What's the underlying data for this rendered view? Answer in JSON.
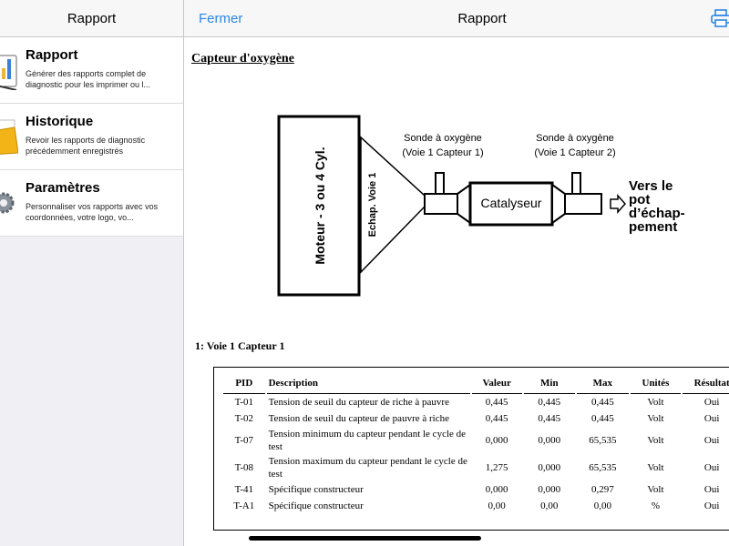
{
  "sidebar": {
    "title": "Rapport",
    "items": [
      {
        "title": "Rapport",
        "desc": "Générer des rapports complet de diagnostic pour les imprimer ou l...",
        "icon": "report-icon"
      },
      {
        "title": "Historique",
        "desc": "Revoir les rapports de diagnostic précédemment enregistrés",
        "icon": "folder-icon"
      },
      {
        "title": "Paramètres",
        "desc": "Personnaliser vos rapports avec vos coordonnées, votre logo, vo...",
        "icon": "gear-icon"
      }
    ]
  },
  "main": {
    "close_label": "Fermer",
    "title": "Rapport",
    "section_title": "Capteur d'oxygène",
    "diagram": {
      "engine_label": "Moteur - 3 ou 4 Cyl.",
      "exhaust_label": "Echap. Voie 1",
      "sensor1_line1": "Sonde à oxygène",
      "sensor1_line2": "(Voie 1 Capteur 1)",
      "sensor2_line1": "Sonde à oxygène",
      "sensor2_line2": "(Voie 1 Capteur 2)",
      "catalyst_label": "Catalyseur",
      "outlet_line1": "Vers le",
      "outlet_line2": "pot",
      "outlet_line3": "d’échap-",
      "outlet_line4": "pement"
    },
    "sub_title": "1: Voie 1 Capteur 1",
    "table": {
      "headers": [
        "PID",
        "Description",
        "Valeur",
        "Min",
        "Max",
        "Unités",
        "Résultat"
      ],
      "rows": [
        {
          "pid": "T-01",
          "desc": "Tension de seuil du capteur de riche à pauvre",
          "valeur": "0,445",
          "min": "0,445",
          "max": "0,445",
          "unites": "Volt",
          "resultat": "Oui"
        },
        {
          "pid": "T-02",
          "desc": "Tension de seuil du capteur de pauvre à riche",
          "valeur": "0,445",
          "min": "0,445",
          "max": "0,445",
          "unites": "Volt",
          "resultat": "Oui"
        },
        {
          "pid": "T-07",
          "desc": "Tension minimum du capteur pendant le cycle de test",
          "valeur": "0,000",
          "min": "0,000",
          "max": "65,535",
          "unites": "Volt",
          "resultat": "Oui"
        },
        {
          "pid": "T-08",
          "desc": "Tension maximum du capteur pendant le cycle de test",
          "valeur": "1,275",
          "min": "0,000",
          "max": "65,535",
          "unites": "Volt",
          "resultat": "Oui"
        },
        {
          "pid": "T-41",
          "desc": "Spécifique constructeur",
          "valeur": "0,000",
          "min": "0,000",
          "max": "0,297",
          "unites": "Volt",
          "resultat": "Oui"
        },
        {
          "pid": "T-A1",
          "desc": "Spécifique constructeur",
          "valeur": "0,00",
          "min": "0,00",
          "max": "0,00",
          "unites": "%",
          "resultat": "Oui"
        }
      ]
    }
  },
  "colors": {
    "accent": "#2c86e6",
    "nav_bg": "#f7f7f7",
    "sidebar_bg": "#f0f0f4"
  }
}
